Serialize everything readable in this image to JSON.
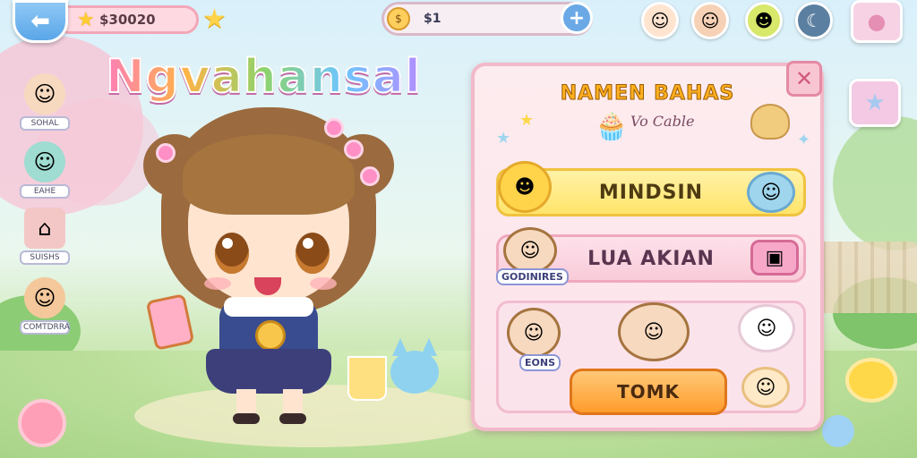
{
  "top_bar": {
    "back_glyph": "⬅",
    "score_value": "$30020",
    "coin_value": "$1",
    "coin_glyph": "$",
    "plus_glyph": "+"
  },
  "game_title": "Ngvahansal",
  "side_characters": [
    {
      "label": "SOHAL",
      "icon": "girl-face-icon"
    },
    {
      "label": "EAHE",
      "icon": "teal-hair-face-icon"
    },
    {
      "label": "SUISHS",
      "icon": "house-icon"
    },
    {
      "label": "COMTDRRA",
      "icon": "boy-face-icon"
    }
  ],
  "panel": {
    "title": "NAMEN BAHAS",
    "subtitle": "Vo Cable",
    "close_glyph": "✕",
    "options": [
      {
        "label": "MINDSIN"
      },
      {
        "label": "LUA AKIAN"
      }
    ],
    "character_tags": [
      "GODINIRES",
      "EONS"
    ],
    "start_label": "TOMK"
  },
  "colors": {
    "accent_pink": "#f2b9c9",
    "accent_yellow": "#ffe46a",
    "accent_orange": "#ff9c2b",
    "accent_blue": "#6aa9e6"
  }
}
